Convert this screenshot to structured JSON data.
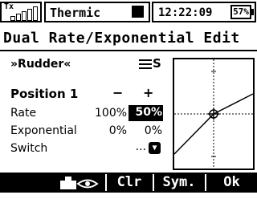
{
  "status": {
    "tx_label": "Tx",
    "model_name": "Thermic",
    "clock": "12:22:09",
    "battery_percent": "57%",
    "battery_level": 0.57
  },
  "title": "Dual Rate/Exponential Edit",
  "control": {
    "name": "»Rudder«",
    "trim_label": "S"
  },
  "position": {
    "label": "Position 1",
    "minus_label": "−",
    "plus_label": "+"
  },
  "rate": {
    "label": "Rate",
    "minus_value": "100%",
    "plus_value": "50%"
  },
  "exponential": {
    "label": "Exponential",
    "minus_value": "0%",
    "plus_value": "0%"
  },
  "switch": {
    "label": "Switch",
    "value": "...",
    "icon": "switch-arrow-icon"
  },
  "softkeys": {
    "view_icon": "servo-view-icon",
    "clear": "Clr",
    "symmetric": "Sym.",
    "ok": "Ok"
  },
  "colors": {
    "foreground": "#000000",
    "background": "#ffffff"
  }
}
